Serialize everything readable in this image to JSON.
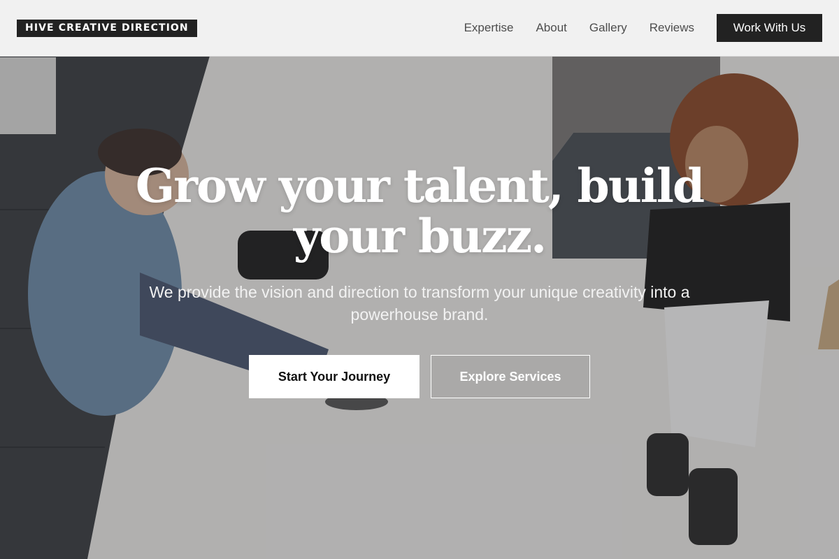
{
  "header": {
    "logo_text": "HIVE CREATIVE DIRECTION",
    "nav": [
      {
        "label": "Expertise"
      },
      {
        "label": "About"
      },
      {
        "label": "Gallery"
      },
      {
        "label": "Reviews"
      }
    ],
    "cta_label": "Work With Us"
  },
  "hero": {
    "title": "Grow your talent, build your buzz.",
    "subtitle": "We provide the vision and direction to transform your unique creativity into a powerhouse brand.",
    "primary_button": "Start Your Journey",
    "secondary_button": "Explore Services",
    "background_image": "photo-photographer-and-model-studio"
  },
  "colors": {
    "dark": "#222222",
    "header_bg": "#f3f3f3",
    "nav_text": "#4d4d4d",
    "hero_text": "#ffffff"
  }
}
